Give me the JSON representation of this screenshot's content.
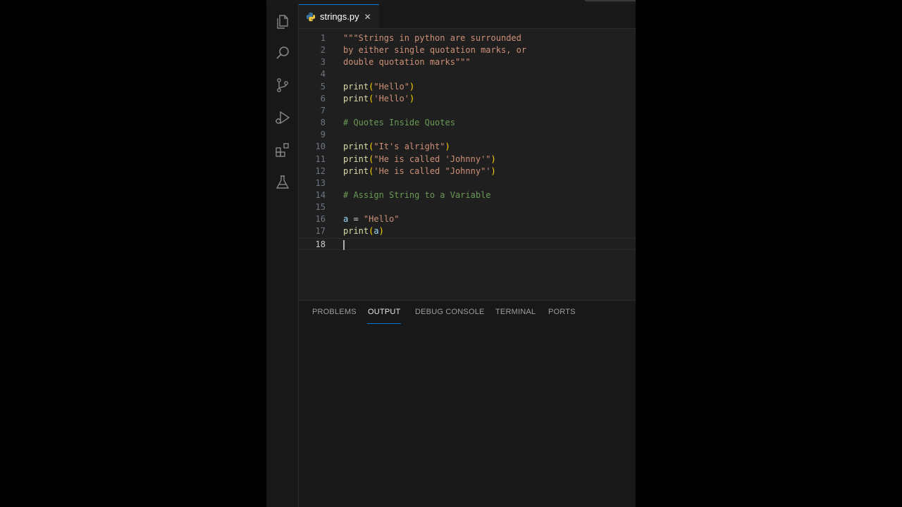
{
  "editor": {
    "tab_label": "strings.py",
    "close_glyph": "✕",
    "lines": [
      {
        "n": "1",
        "tokens": [
          {
            "t": "str",
            "v": "\"\"\"Strings in python are surrounded"
          }
        ]
      },
      {
        "n": "2",
        "tokens": [
          {
            "t": "str",
            "v": "by either single quotation marks, or"
          }
        ]
      },
      {
        "n": "3",
        "tokens": [
          {
            "t": "str",
            "v": "double quotation marks\"\"\""
          }
        ]
      },
      {
        "n": "4",
        "tokens": []
      },
      {
        "n": "5",
        "tokens": [
          {
            "t": "fn",
            "v": "print"
          },
          {
            "t": "paren",
            "v": "("
          },
          {
            "t": "str",
            "v": "\"Hello\""
          },
          {
            "t": "paren",
            "v": ")"
          }
        ]
      },
      {
        "n": "6",
        "tokens": [
          {
            "t": "fn",
            "v": "print"
          },
          {
            "t": "paren",
            "v": "("
          },
          {
            "t": "str",
            "v": "'Hello'"
          },
          {
            "t": "paren",
            "v": ")"
          }
        ]
      },
      {
        "n": "7",
        "tokens": []
      },
      {
        "n": "8",
        "tokens": [
          {
            "t": "cmt",
            "v": "# Quotes Inside Quotes"
          }
        ]
      },
      {
        "n": "9",
        "tokens": []
      },
      {
        "n": "10",
        "tokens": [
          {
            "t": "fn",
            "v": "print"
          },
          {
            "t": "paren",
            "v": "("
          },
          {
            "t": "str",
            "v": "\"It's alright\""
          },
          {
            "t": "paren",
            "v": ")"
          }
        ]
      },
      {
        "n": "11",
        "tokens": [
          {
            "t": "fn",
            "v": "print"
          },
          {
            "t": "paren",
            "v": "("
          },
          {
            "t": "str",
            "v": "\"He is called 'Johnny'\""
          },
          {
            "t": "paren",
            "v": ")"
          }
        ]
      },
      {
        "n": "12",
        "tokens": [
          {
            "t": "fn",
            "v": "print"
          },
          {
            "t": "paren",
            "v": "("
          },
          {
            "t": "str",
            "v": "'He is called \"Johnny\"'"
          },
          {
            "t": "paren",
            "v": ")"
          }
        ]
      },
      {
        "n": "13",
        "tokens": []
      },
      {
        "n": "14",
        "tokens": [
          {
            "t": "cmt",
            "v": "# Assign String to a Variable"
          }
        ]
      },
      {
        "n": "15",
        "tokens": []
      },
      {
        "n": "16",
        "tokens": [
          {
            "t": "var",
            "v": "a"
          },
          {
            "t": "op",
            "v": " = "
          },
          {
            "t": "str",
            "v": "\"Hello\""
          }
        ]
      },
      {
        "n": "17",
        "tokens": [
          {
            "t": "fn",
            "v": "print"
          },
          {
            "t": "paren",
            "v": "("
          },
          {
            "t": "var",
            "v": "a"
          },
          {
            "t": "paren",
            "v": ")"
          }
        ]
      },
      {
        "n": "18",
        "tokens": [],
        "current": true
      }
    ]
  },
  "activity_bar": {
    "items": [
      {
        "name": "explorer-icon"
      },
      {
        "name": "search-icon"
      },
      {
        "name": "source-control-icon"
      },
      {
        "name": "run-debug-icon"
      },
      {
        "name": "extensions-icon"
      },
      {
        "name": "testing-flask-icon"
      }
    ]
  },
  "panel": {
    "tabs": [
      {
        "label": "PROBLEMS",
        "active": false
      },
      {
        "label": "OUTPUT",
        "active": true
      },
      {
        "label": "DEBUG CONSOLE",
        "active": false
      },
      {
        "label": "TERMINAL",
        "active": false
      },
      {
        "label": "PORTS",
        "active": false
      }
    ]
  },
  "colors": {
    "accent": "#0078d4",
    "string": "#ce9178",
    "function": "#dcdcaa",
    "variable": "#9cdcfe",
    "comment": "#6a9955",
    "bracket": "#ffd700"
  }
}
